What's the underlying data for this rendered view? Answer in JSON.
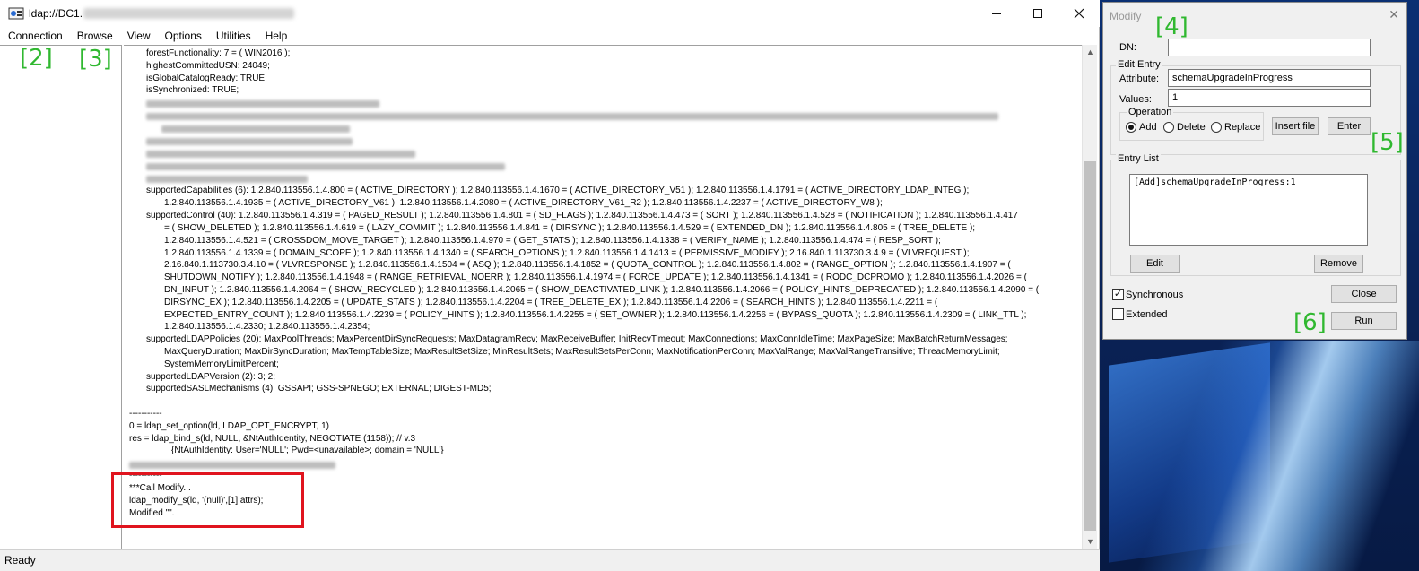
{
  "main_window": {
    "title": "ldap://DC1.",
    "menu": [
      "Connection",
      "Browse",
      "View",
      "Options",
      "Utilities",
      "Help"
    ],
    "status": "Ready"
  },
  "output": {
    "lines": [
      "forestFunctionality: 7 = ( WIN2016 );",
      "highestCommittedUSN: 24049;",
      "isGlobalCatalogReady: TRUE;",
      "isSynchronized: TRUE;",
      "supportedCapabilities (6): 1.2.840.113556.1.4.800 = ( ACTIVE_DIRECTORY ); 1.2.840.113556.1.4.1670 = ( ACTIVE_DIRECTORY_V51 ); 1.2.840.113556.1.4.1791 = ( ACTIVE_DIRECTORY_LDAP_INTEG );",
      "1.2.840.113556.1.4.1935 = ( ACTIVE_DIRECTORY_V61 ); 1.2.840.113556.1.4.2080 = ( ACTIVE_DIRECTORY_V61_R2 ); 1.2.840.113556.1.4.2237 = ( ACTIVE_DIRECTORY_W8 );",
      "supportedControl (40): 1.2.840.113556.1.4.319 = ( PAGED_RESULT ); 1.2.840.113556.1.4.801 = ( SD_FLAGS ); 1.2.840.113556.1.4.473 = ( SORT ); 1.2.840.113556.1.4.528 = ( NOTIFICATION ); 1.2.840.113556.1.4.417",
      "= ( SHOW_DELETED ); 1.2.840.113556.1.4.619 = ( LAZY_COMMIT ); 1.2.840.113556.1.4.841 = ( DIRSYNC ); 1.2.840.113556.1.4.529 = ( EXTENDED_DN ); 1.2.840.113556.1.4.805 = ( TREE_DELETE );",
      "1.2.840.113556.1.4.521 = ( CROSSDOM_MOVE_TARGET ); 1.2.840.113556.1.4.970 = ( GET_STATS ); 1.2.840.113556.1.4.1338 = ( VERIFY_NAME ); 1.2.840.113556.1.4.474 = ( RESP_SORT );",
      "1.2.840.113556.1.4.1339 = ( DOMAIN_SCOPE ); 1.2.840.113556.1.4.1340 = ( SEARCH_OPTIONS ); 1.2.840.113556.1.4.1413 = ( PERMISSIVE_MODIFY ); 2.16.840.1.113730.3.4.9 = ( VLVREQUEST );",
      "2.16.840.1.113730.3.4.10 = ( VLVRESPONSE ); 1.2.840.113556.1.4.1504 = ( ASQ ); 1.2.840.113556.1.4.1852 = ( QUOTA_CONTROL ); 1.2.840.113556.1.4.802 = ( RANGE_OPTION ); 1.2.840.113556.1.4.1907 = (",
      "SHUTDOWN_NOTIFY ); 1.2.840.113556.1.4.1948 = ( RANGE_RETRIEVAL_NOERR ); 1.2.840.113556.1.4.1974 = ( FORCE_UPDATE ); 1.2.840.113556.1.4.1341 = ( RODC_DCPROMO ); 1.2.840.113556.1.4.2026 = (",
      "DN_INPUT ); 1.2.840.113556.1.4.2064 = ( SHOW_RECYCLED ); 1.2.840.113556.1.4.2065 = ( SHOW_DEACTIVATED_LINK ); 1.2.840.113556.1.4.2066 = ( POLICY_HINTS_DEPRECATED ); 1.2.840.113556.1.4.2090 = (",
      "DIRSYNC_EX ); 1.2.840.113556.1.4.2205 = ( UPDATE_STATS ); 1.2.840.113556.1.4.2204 = ( TREE_DELETE_EX ); 1.2.840.113556.1.4.2206 = ( SEARCH_HINTS ); 1.2.840.113556.1.4.2211 = (",
      "EXPECTED_ENTRY_COUNT ); 1.2.840.113556.1.4.2239 = ( POLICY_HINTS ); 1.2.840.113556.1.4.2255 = ( SET_OWNER ); 1.2.840.113556.1.4.2256 = ( BYPASS_QUOTA ); 1.2.840.113556.1.4.2309 = ( LINK_TTL );",
      "1.2.840.113556.1.4.2330; 1.2.840.113556.1.4.2354;",
      "supportedLDAPPolicies (20): MaxPoolThreads; MaxPercentDirSyncRequests; MaxDatagramRecv; MaxReceiveBuffer; InitRecvTimeout; MaxConnections; MaxConnIdleTime; MaxPageSize; MaxBatchReturnMessages;",
      "MaxQueryDuration; MaxDirSyncDuration; MaxTempTableSize; MaxResultSetSize; MinResultSets; MaxResultSetsPerConn; MaxNotificationPerConn; MaxValRange; MaxValRangeTransitive; ThreadMemoryLimit;",
      "SystemMemoryLimitPercent;",
      "supportedLDAPVersion (2): 3; 2;",
      "supportedSASLMechanisms (4): GSSAPI; GSS-SPNEGO; EXTERNAL; DIGEST-MD5;",
      "-----------",
      "0 = ldap_set_option(ld, LDAP_OPT_ENCRYPT, 1)",
      "res = ldap_bind_s(ld, NULL, &NtAuthIdentity, NEGOTIATE (1158)); // v.3",
      "{NtAuthIdentity: User='NULL'; Pwd=<unavailable>; domain = 'NULL'}",
      "-----------",
      "***Call Modify...",
      "ldap_modify_s(ld, '(null)',[1] attrs);",
      "Modified \"\"."
    ]
  },
  "annotations": {
    "a2": "[2]",
    "a3": "[3]",
    "a4": "[4]",
    "a5": "[5]",
    "a6": "[6]"
  },
  "modify_dialog": {
    "title": "Modify",
    "close_glyph": "✕",
    "dn_label": "DN:",
    "dn_value": "",
    "edit_entry_label": "Edit Entry",
    "attribute_label": "Attribute:",
    "attribute_value": "schemaUpgradeInProgress",
    "values_label": "Values:",
    "values_value": "1",
    "operation_label": "Operation",
    "op_add": "Add",
    "op_delete": "Delete",
    "op_replace": "Replace",
    "selected_op": "Add",
    "insert_file_button": "Insert file",
    "enter_button": "Enter",
    "entry_list_label": "Entry List",
    "entries": [
      "[Add]schemaUpgradeInProgress:1"
    ],
    "edit_button": "Edit",
    "remove_button": "Remove",
    "synchronous_label": "Synchronous",
    "synchronous_checked": true,
    "extended_label": "Extended",
    "extended_checked": false,
    "close_button": "Close",
    "run_button": "Run"
  },
  "colors": {
    "annotation": "#30b830",
    "highlight_border": "#e0141e"
  }
}
